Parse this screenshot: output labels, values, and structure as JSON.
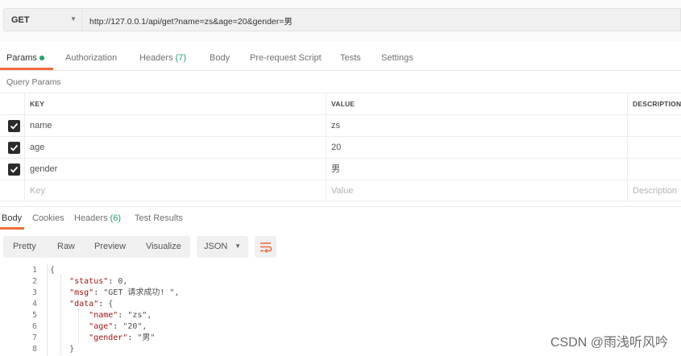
{
  "request": {
    "method": "GET",
    "url": "http://127.0.0.1/api/get?name=zs&age=20&gender=男"
  },
  "request_tabs": [
    {
      "label": "Params",
      "active": true
    },
    {
      "label": "Authorization"
    },
    {
      "label": "Headers",
      "count": "(7)"
    },
    {
      "label": "Body"
    },
    {
      "label": "Pre-request Script"
    },
    {
      "label": "Tests"
    },
    {
      "label": "Settings"
    }
  ],
  "query_params": {
    "title": "Query Params",
    "headers": {
      "key": "KEY",
      "value": "VALUE",
      "description": "DESCRIPTION"
    },
    "rows": [
      {
        "key": "name",
        "value": "zs",
        "checked": true
      },
      {
        "key": "age",
        "value": "20",
        "checked": true
      },
      {
        "key": "gender",
        "value": "男",
        "checked": true
      }
    ],
    "placeholder": {
      "key": "Key",
      "value": "Value",
      "description": "Description"
    }
  },
  "response_tabs": [
    {
      "label": "Body",
      "active": true
    },
    {
      "label": "Cookies"
    },
    {
      "label": "Headers",
      "count": "(6)"
    },
    {
      "label": "Test Results"
    }
  ],
  "view_modes": [
    "Pretty",
    "Raw",
    "Preview",
    "Visualize"
  ],
  "format": "JSON",
  "code_lines": [
    {
      "n": "1",
      "t": "{"
    },
    {
      "n": "2",
      "t": "    \"status\": 0,"
    },
    {
      "n": "3",
      "t": "    \"msg\": \"GET 请求成功! \","
    },
    {
      "n": "4",
      "t": "    \"data\": {"
    },
    {
      "n": "5",
      "t": "        \"name\": \"zs\","
    },
    {
      "n": "6",
      "t": "        \"age\": \"20\","
    },
    {
      "n": "7",
      "t": "        \"gender\": \"男\""
    },
    {
      "n": "8",
      "t": "    }"
    }
  ],
  "watermark": "CSDN @雨浅听风吟",
  "colors": {
    "accent": "#ef6b3a",
    "success": "#21a366"
  }
}
